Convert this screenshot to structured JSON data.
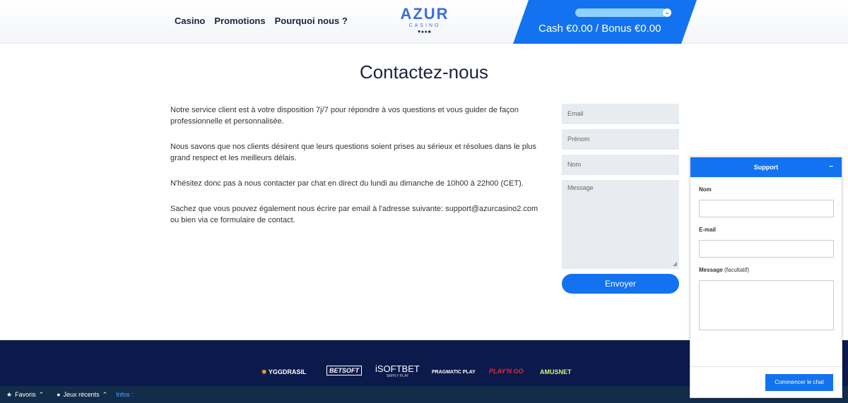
{
  "header": {
    "nav": [
      "Casino",
      "Promotions",
      "Pourquoi nous ?"
    ],
    "logo": {
      "main": "AZUR",
      "sub": "CASINO",
      "suits": "♥♠♦♣"
    },
    "balance": "Cash €0.00 / Bonus €0.00",
    "account_chevron": "⌄"
  },
  "page": {
    "title": "Contactez-nous",
    "paragraphs": [
      "Notre service client est à votre disposition 7j/7 pour répondre à vos questions et vous guider de façon professionnelle et personnalisée.",
      "Nous savons que nos clients désirent que leurs questions soient prises au sérieux et résolues dans le plus grand respect et les meilleurs délais.",
      "N'hésitez donc pas à nous contacter par chat en direct du lundi au dimanche de 10h00 à 22h00 (CET).",
      "Sachez que vous pouvez également nous écrire par email à l'adresse suivante: support@azurcasino2.com ou bien via ce formulaire de contact."
    ]
  },
  "form": {
    "email_placeholder": "Email",
    "firstname_placeholder": "Prénom",
    "name_placeholder": "Nom",
    "message_placeholder": "Message",
    "submit_label": "Envoyer"
  },
  "providers": [
    "YGGDRASIL",
    "BETSOFT",
    "iSOFTBET",
    "PRAGMATIC PLAY",
    "PLAY'N GO",
    "AMUSNET"
  ],
  "provider_sub": {
    "isoftbet": "SIMPLY PLAY"
  },
  "bottom_bar": {
    "favorites": "Favoris",
    "recent": "Jeux récents",
    "info": "Infos :"
  },
  "support": {
    "title": "Support",
    "minimize": "−",
    "name_label": "Nom",
    "email_label": "E-mail",
    "message_label": "Message",
    "message_optional": "(facultatif)",
    "start_chat_label": "Commencer le chat"
  },
  "colors": {
    "primary_blue": "#1372f0",
    "footer_navy": "#0b1a4b",
    "bottom_bar": "#132c4a"
  }
}
